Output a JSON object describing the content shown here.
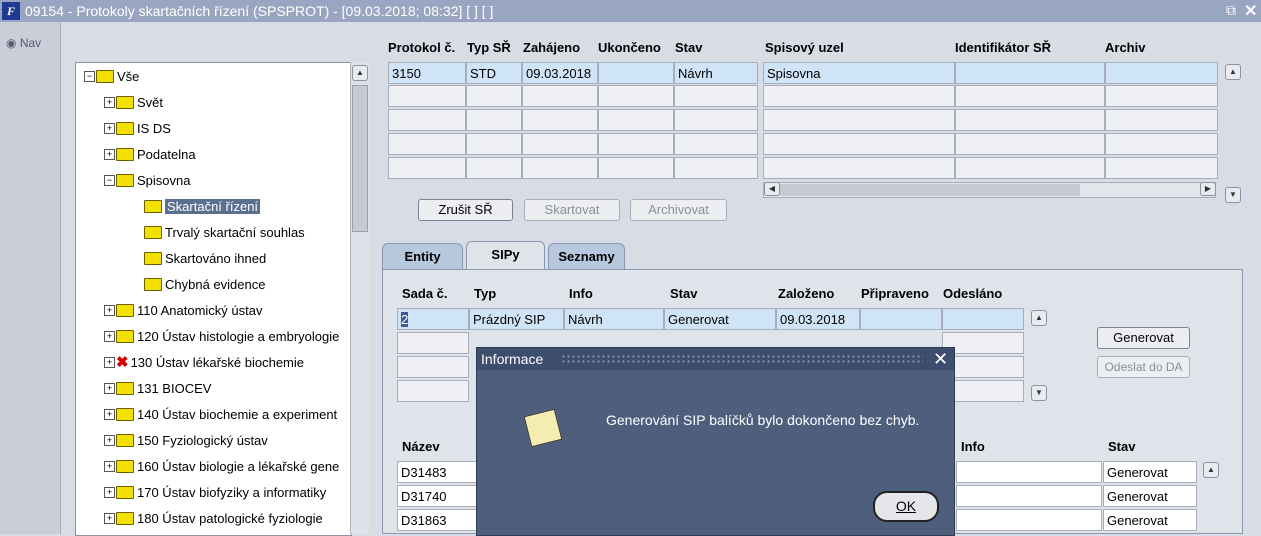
{
  "window": {
    "title": "09154 - Protokoly skartačních řízení (SPSPROT) - [09.03.2018; 08:32]  [ ]  [ ]",
    "app_logo_text": "F",
    "nav_label": "Nav"
  },
  "tree": {
    "root": "Vše",
    "items": [
      {
        "label": "Svět"
      },
      {
        "label": "IS DS"
      },
      {
        "label": "Podatelna"
      },
      {
        "label": "Spisovna"
      },
      {
        "label": "Skartační řízení"
      },
      {
        "label": "Trvalý skartační souhlas"
      },
      {
        "label": "Skartováno ihned"
      },
      {
        "label": "Chybná evidence"
      },
      {
        "label": "110 Anatomický ústav"
      },
      {
        "label": "120 Ústav histologie a embryologie"
      },
      {
        "label": "130 Ústav lékařské biochemie"
      },
      {
        "label": "131 BIOCEV"
      },
      {
        "label": "140 Ústav biochemie a experiment"
      },
      {
        "label": "150 Fyziologický ústav"
      },
      {
        "label": "160 Ústav biologie a lékařské gene"
      },
      {
        "label": "170 Ústav biofyziky a informatiky"
      },
      {
        "label": "180 Ústav patologické fyziologie"
      }
    ]
  },
  "protocols": {
    "headers": [
      "Protokol č.",
      "Typ SŘ",
      "Zahájeno",
      "Ukončeno",
      "Stav",
      "Spisový uzel",
      "Identifikátor SŘ",
      "Archiv"
    ],
    "row": [
      "3150",
      "STD",
      "09.03.2018",
      "",
      "Návrh",
      "Spisovna",
      "",
      ""
    ],
    "buttons": {
      "cancel": "Zrušit SŘ",
      "shred": "Skartovat",
      "archive": "Archivovat"
    }
  },
  "tabs": [
    "Entity",
    "SIPy",
    "Seznamy"
  ],
  "sip": {
    "headers": [
      "Sada č.",
      "Typ",
      "Info",
      "Stav",
      "Založeno",
      "Připraveno",
      "Odesláno"
    ],
    "row": [
      "2",
      "Prázdný SIP",
      "Návrh",
      "Generovat",
      "09.03.2018",
      "",
      ""
    ],
    "buttons": {
      "generate": "Generovat",
      "send": "Odeslat do DA"
    }
  },
  "entities": {
    "headers": {
      "name": "Název",
      "info": "Info",
      "status": "Stav"
    },
    "rows": [
      {
        "name": "D31483",
        "status": "Generovat"
      },
      {
        "name": "D31740",
        "status": "Generovat"
      },
      {
        "name": "D31863",
        "status": "Generovat"
      }
    ]
  },
  "dialog": {
    "title": "Informace",
    "message": "Generování SIP balíčků bylo dokončeno bez chyb.",
    "ok": "OK"
  }
}
